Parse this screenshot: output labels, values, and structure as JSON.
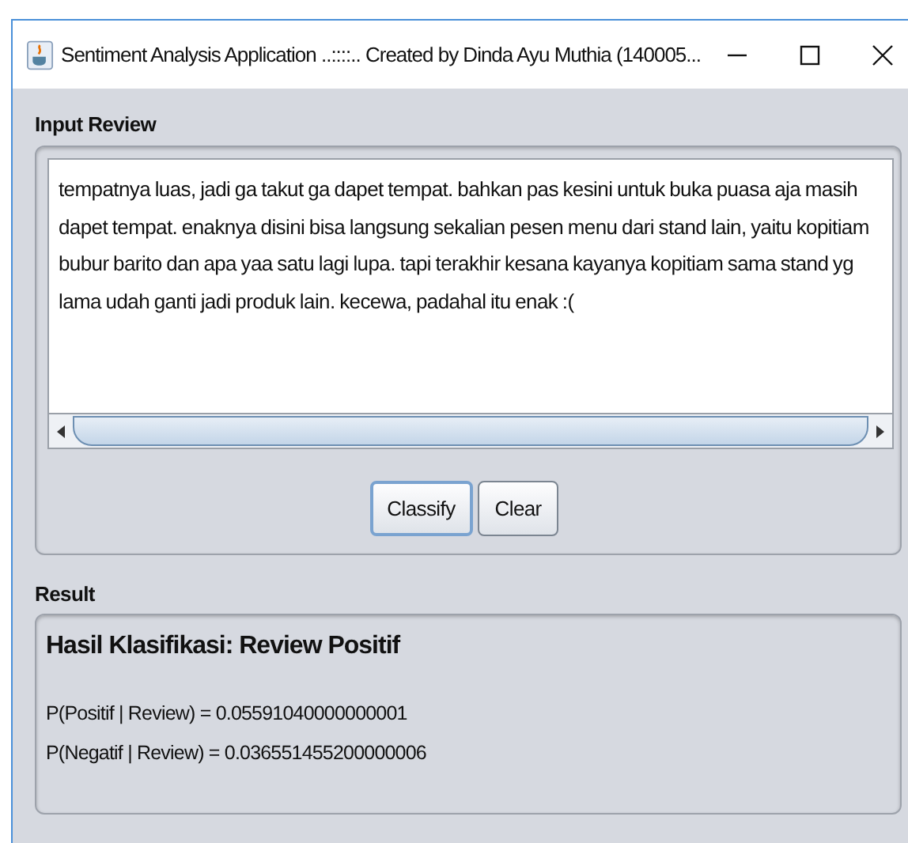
{
  "window": {
    "title": "Sentiment Analysis Application ..::::.. Created by Dinda Ayu Muthia (140005..."
  },
  "input_section": {
    "label": "Input Review",
    "review_text": "tempatnya luas, jadi ga takut ga dapet tempat. bahkan pas kesini untuk buka puasa aja masih dapet tempat. enaknya disini bisa langsung sekalian pesen menu dari stand lain, yaitu kopitiam bubur barito dan apa yaa satu lagi lupa. tapi terakhir kesana kayanya kopitiam sama stand yg lama udah ganti jadi produk lain. kecewa, padahal itu enak :("
  },
  "buttons": [
    {
      "label": "Classify",
      "focused": true
    },
    {
      "label": "Clear",
      "focused": false
    }
  ],
  "result_section": {
    "label": "Result",
    "heading": "Hasil Klasifikasi: Review Positif",
    "lines": [
      "P(Positif | Review) = 0.05591040000000001",
      "P(Negatif | Review) = 0.036551455200000006"
    ]
  }
}
